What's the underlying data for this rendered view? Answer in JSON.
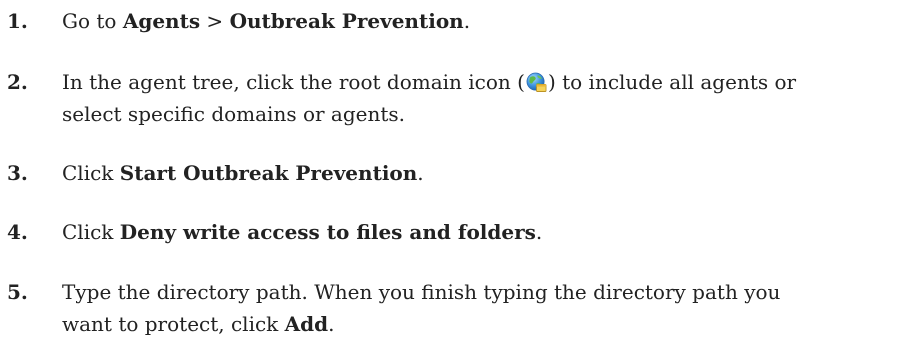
{
  "steps": [
    {
      "number": "1.",
      "parts": [
        "Go to ",
        "Agents",
        " > ",
        "Outbreak Prevention",
        "."
      ]
    },
    {
      "number": "2.",
      "parts": [
        "In the agent tree, click the root domain icon (",
        ") to include all agents or",
        "select specific domains or agents."
      ],
      "icon": "root-domain-globe-icon"
    },
    {
      "number": "3.",
      "parts": [
        "Click ",
        "Start Outbreak Prevention",
        "."
      ]
    },
    {
      "number": "4.",
      "parts": [
        "Click ",
        "Deny write access to files and folders",
        "."
      ]
    },
    {
      "number": "5.",
      "parts": [
        "Type the directory path. When you finish typing the directory path you",
        "want to protect, click ",
        "Add",
        "."
      ]
    }
  ]
}
